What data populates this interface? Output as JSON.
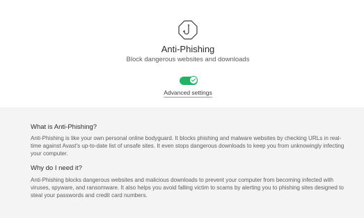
{
  "header": {
    "title": "Anti-Phishing",
    "subtitle": "Block dangerous websites and downloads",
    "toggle_state": "on",
    "advanced_settings_label": "Advanced settings",
    "icon": "shield-hook-icon",
    "close_icon": "close-icon",
    "accent_color": "#21b363"
  },
  "info": {
    "q1": "What is Anti-Phishing?",
    "a1": "Anti-Phishing is like your own personal online bodyguard. It blocks phishing and malware websites by checking URLs in real-time against Avast's up-to-date list of unsafe sites. It even stops dangerous downloads to keep you from unknowingly infecting your computer.",
    "q2": "Why do I need it?",
    "a2": "Anti-Phishing blocks dangerous websites and malicious downloads to prevent your computer from becoming infected with viruses, spyware, and ransomware. It also helps you avoid falling victim to scams by alerting you to phishing sites designed to steal your passwords and credit card numbers."
  }
}
